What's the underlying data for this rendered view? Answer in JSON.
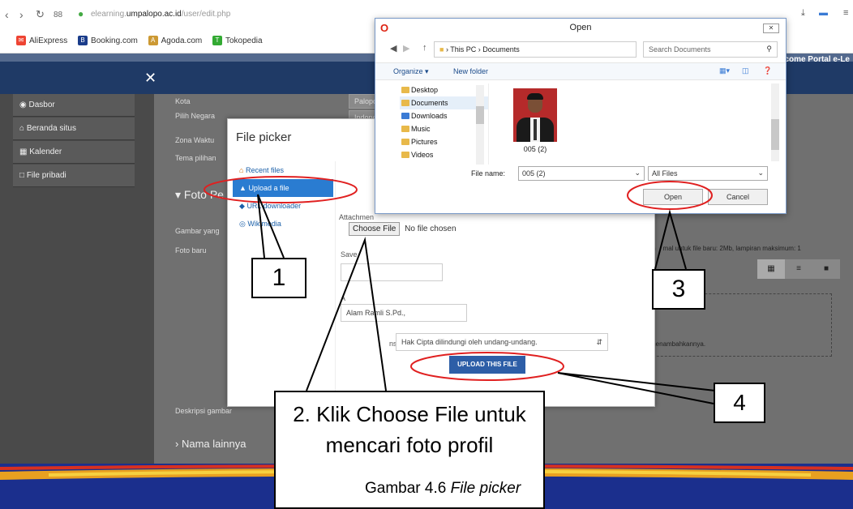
{
  "browser": {
    "url_prefix": "elearning.",
    "url_domain": "umpalopo.ac.id",
    "url_path": "/user/edit.php",
    "bookmarks": [
      "AliExpress",
      "Booking.com",
      "Agoda.com",
      "Tokopedia"
    ]
  },
  "header": {
    "welcome": "Welcome Portal e-Le"
  },
  "sidebar": {
    "items": [
      "Dasbor",
      "Beranda situs",
      "Kalender",
      "File pribadi"
    ]
  },
  "form": {
    "kota_label": "Kota",
    "kota_value": "Palopo",
    "negara_label": "Pilih Negara",
    "negara_value": "Indone",
    "zona_label": "Zona Waktu",
    "tema_label": "Tema pilihan",
    "foto_section": "Foto Pe",
    "gambar_label": "Gambar yang",
    "foto_baru_label": "Foto baru",
    "size_note": "m    mal untuk file baru: 2Mb, lampiran maksimum: 1",
    "drop_note": "menambahkannya.",
    "deskripsi_label": "Deskripsi gambar",
    "nama_lain": "Nama lainnya"
  },
  "file_picker": {
    "title": "File picker",
    "nav": [
      "Recent files",
      "Upload a file",
      "URL downloader",
      "Wikimedia"
    ],
    "attachment_label": "Attachmen",
    "choose_file": "Choose File",
    "no_file": "No file chosen",
    "save_label": "Save",
    "author_label": "A",
    "author_value": "Alam Ramli S.Pd.,",
    "license_label": "nse",
    "license_value": "Hak Cipta dilindungi oleh undang-undang.",
    "upload_button": "UPLOAD THIS FILE"
  },
  "open_dialog": {
    "title": "Open",
    "breadcrumb": "This PC  ›  Documents",
    "search_placeholder": "Search Documents",
    "organize": "Organize ▾",
    "new_folder": "New folder",
    "folders": [
      "Desktop",
      "Documents",
      "Downloads",
      "Music",
      "Pictures",
      "Videos"
    ],
    "file_caption": "005 (2)",
    "file_name_label": "File name:",
    "file_name_value": "005 (2)",
    "file_type": "All Files",
    "open_button": "Open",
    "cancel_button": "Cancel"
  },
  "annotations": {
    "step1": "1",
    "step2": "2. Klik Choose File untuk mencari foto profil",
    "step3": "3",
    "step4": "4",
    "caption_prefix": "Gambar 4.6 ",
    "caption_italic": "File picker"
  },
  "colors": {
    "navbar": "#1f3a66",
    "annotation_red": "#e02020",
    "band_blue": "#1b2f8d"
  }
}
